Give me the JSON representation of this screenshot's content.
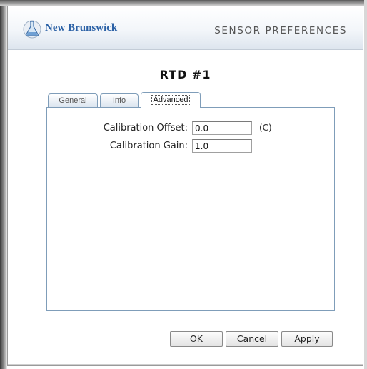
{
  "header": {
    "brand": "New Brunswick",
    "title": "SENSOR PREFERENCES",
    "logo_icon": "flask-icon",
    "brand_color": "#2b61a6"
  },
  "sensor_title": "RTD #1",
  "tabs": [
    {
      "label": "General",
      "active": false
    },
    {
      "label": "Info",
      "active": false
    },
    {
      "label": "Advanced",
      "active": true
    }
  ],
  "fields": {
    "calibration_offset": {
      "label": "Calibration Offset:",
      "value": "0.0",
      "unit": "(C)"
    },
    "calibration_gain": {
      "label": "Calibration Gain:",
      "value": "1.0"
    }
  },
  "buttons": {
    "ok": "OK",
    "cancel": "Cancel",
    "apply": "Apply"
  },
  "colors": {
    "tab_border": "#7f9db9",
    "header_gradient_end": "#dde5ee"
  }
}
